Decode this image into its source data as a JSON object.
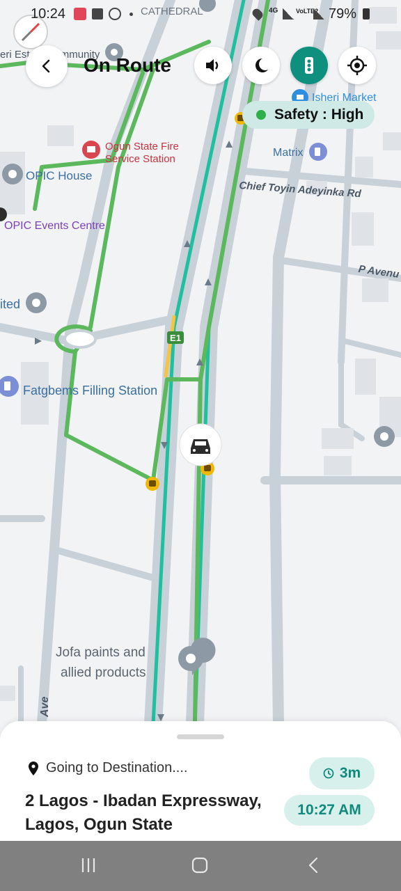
{
  "status_bar": {
    "time": "10:24",
    "battery": "79%",
    "network": "4G",
    "lte": "VoLTE2"
  },
  "header": {
    "title": "On Route",
    "back_icon": "chevron-left-icon",
    "sound_icon": "speaker-icon",
    "night_icon": "moon-icon",
    "traffic_icon": "traffic-light-icon",
    "locate_icon": "crosshair-icon"
  },
  "safety": {
    "label": "Safety : High",
    "dot_color": "#2bb04a"
  },
  "map": {
    "labels": {
      "cathedral": "CATHEDRAL",
      "community": "eri Estate Community",
      "fire_station_line1": "Ogun State Fire",
      "fire_station_line2": "Service Station",
      "opic_house": "OPIC House",
      "opic_events": "OPIC Events Centre",
      "ited": "ited",
      "fatgbems": "Fatgbems Filling Station",
      "jofa_line1": "Jofa paints and",
      "jofa_line2": "allied products",
      "isheri_market": "Isheri Market",
      "matrix": "Matrix",
      "chief_toyin": "Chief Toyin Adeyinka Rd",
      "p_avenue": "P Avenu",
      "ave": "Ave",
      "e1_badge": "E1"
    }
  },
  "sheet": {
    "going_label": "Going to Destination....",
    "destination": "2 Lagos - Ibadan Expressway, Lagos, Ogun State",
    "duration": "3m",
    "arrival": "10:27 AM"
  },
  "colors": {
    "route_green": "#5cb85c",
    "route_teal": "#1fbf9f",
    "accent": "#0f8a7c",
    "traffic_button": "#0f8f7e"
  }
}
